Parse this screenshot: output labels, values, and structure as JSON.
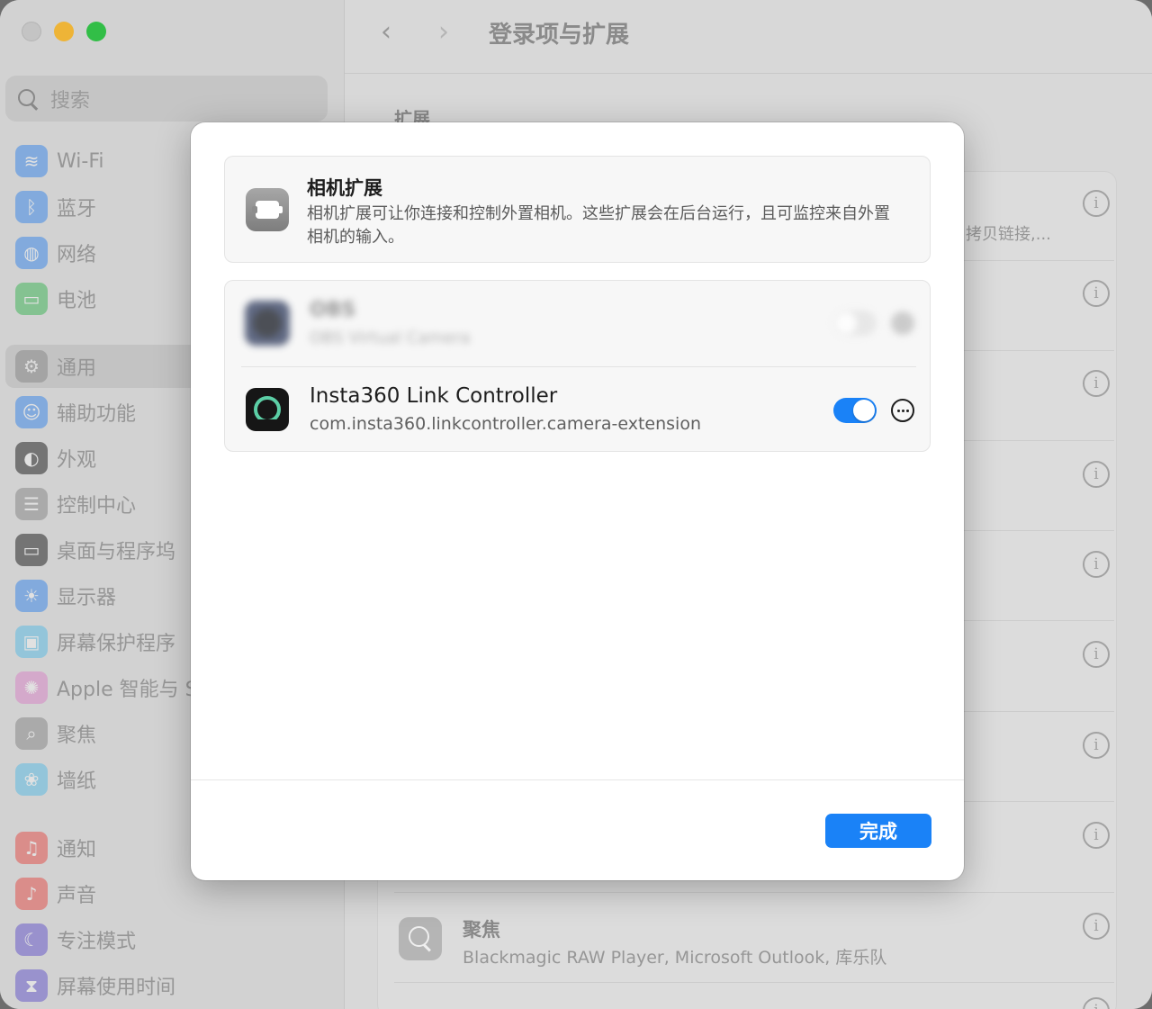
{
  "window": {
    "title": "登录项与扩展",
    "nav_back_glyph": "‹",
    "nav_forward_glyph": "›",
    "section_heading": "扩展",
    "bg_row_subtitle_partial": "拷贝链接,...",
    "focus_row": {
      "title": "聚焦",
      "subtitle": "Blackmagic RAW Player, Microsoft Outlook, 库乐队"
    }
  },
  "sidebar": {
    "search_placeholder": "搜索",
    "items": [
      {
        "label": "Wi-Fi",
        "icon": "wifi-icon",
        "color": "#3a8ef6",
        "glyph": "≋"
      },
      {
        "label": "蓝牙",
        "icon": "bluetooth-icon",
        "color": "#3a8ef6",
        "glyph": "ᛒ"
      },
      {
        "label": "网络",
        "icon": "globe-icon",
        "color": "#3a8ef6",
        "glyph": "◍"
      },
      {
        "label": "电池",
        "icon": "battery-icon",
        "color": "#3fbf5a",
        "glyph": "▭"
      },
      {
        "label": "通用",
        "icon": "gear-icon",
        "color": "#8e8e8e",
        "glyph": "⚙",
        "active": true
      },
      {
        "label": "辅助功能",
        "icon": "accessibility-icon",
        "color": "#3a8ef6",
        "glyph": "☺"
      },
      {
        "label": "外观",
        "icon": "appearance-icon",
        "color": "#1e1e1e",
        "glyph": "◐"
      },
      {
        "label": "控制中心",
        "icon": "control-center-icon",
        "color": "#8e8e8e",
        "glyph": "☰"
      },
      {
        "label": "桌面与程序坞",
        "icon": "desktop-dock-icon",
        "color": "#1e1e1e",
        "glyph": "▭"
      },
      {
        "label": "显示器",
        "icon": "display-icon",
        "color": "#3a8ef6",
        "glyph": "☀"
      },
      {
        "label": "屏幕保护程序",
        "icon": "screensaver-icon",
        "color": "#5ec6f0",
        "glyph": "▣"
      },
      {
        "label": "Apple 智能与 S",
        "icon": "apple-intelligence-icon",
        "color": "#e58bd0",
        "glyph": "✺"
      },
      {
        "label": "聚焦",
        "icon": "spotlight-icon",
        "color": "#8e8e8e",
        "glyph": "⌕"
      },
      {
        "label": "墙纸",
        "icon": "wallpaper-icon",
        "color": "#5ec6f0",
        "glyph": "❀"
      },
      {
        "label": "通知",
        "icon": "notifications-icon",
        "color": "#f0514a",
        "glyph": "♫"
      },
      {
        "label": "声音",
        "icon": "sound-icon",
        "color": "#f0514a",
        "glyph": "♪"
      },
      {
        "label": "专注模式",
        "icon": "focus-icon",
        "color": "#6a5bd6",
        "glyph": "☾"
      },
      {
        "label": "屏幕使用时间",
        "icon": "screen-time-icon",
        "color": "#6a5bd6",
        "glyph": "⧗"
      }
    ]
  },
  "modal": {
    "header": {
      "title": "相机扩展",
      "description": "相机扩展可让你连接和控制外置相机。这些扩展会在后台运行，且可监控来自外置相机的输入。"
    },
    "extensions": [
      {
        "name": "OBS",
        "bundle": "OBS Virtual Camera",
        "enabled": false,
        "blurred": true
      },
      {
        "name": "Insta360 Link Controller",
        "bundle": "com.insta360.linkcontroller.camera-extension",
        "enabled": true
      }
    ],
    "done_label": "完成"
  },
  "colors": {
    "accent": "#1a82f7",
    "traffic_close": "#cfcfcf",
    "traffic_minimize": "#febc2e",
    "traffic_zoom": "#28c840"
  }
}
